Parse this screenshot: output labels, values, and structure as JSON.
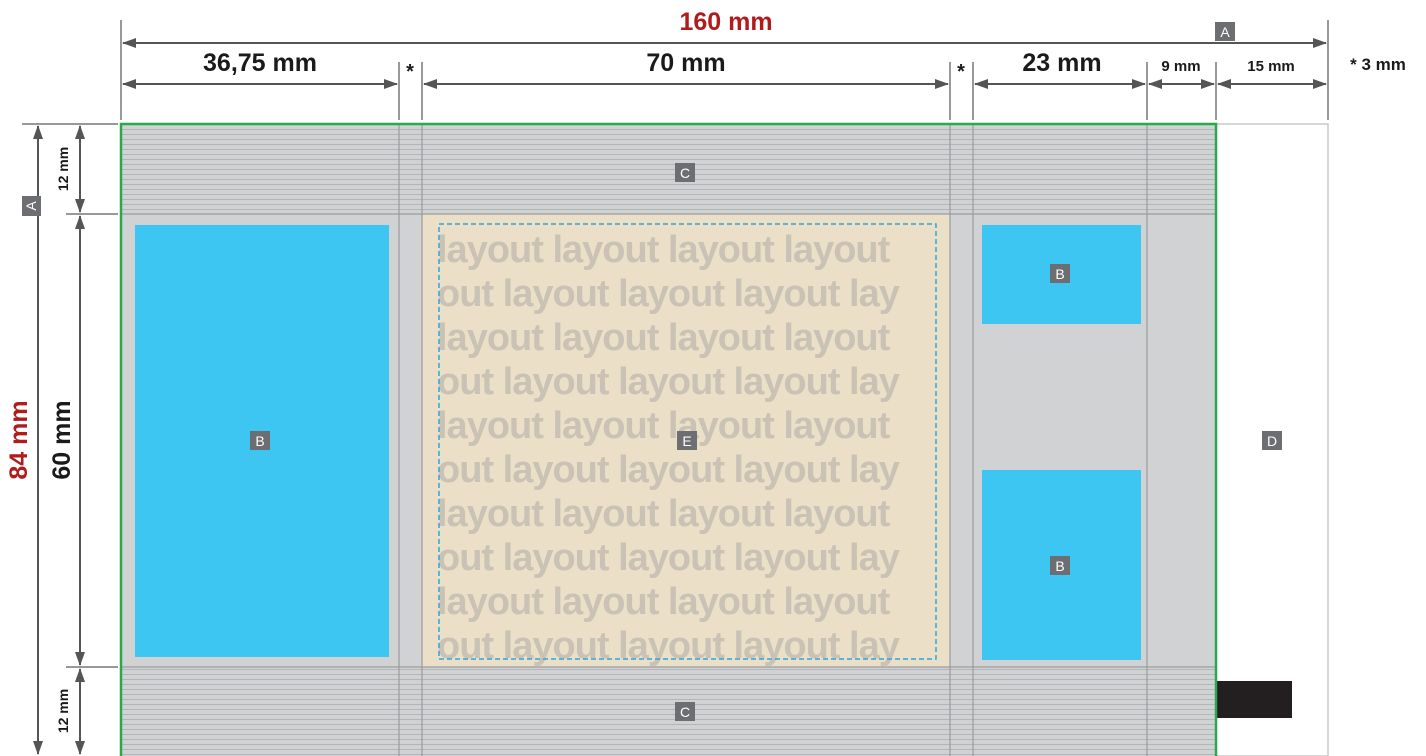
{
  "dimensions": {
    "total_width": "160 mm",
    "col1": "36,75 mm",
    "col2": "70 mm",
    "col3": "23 mm",
    "col4": "9 mm",
    "col5": "15 mm",
    "gap_marker": "*",
    "gap_note": "* 3 mm",
    "total_height": "84 mm",
    "row_top": "12 mm",
    "row_mid": "60 mm",
    "row_bottom": "12 mm"
  },
  "labels": {
    "a": "A",
    "b": "B",
    "c": "C",
    "d": "D",
    "e": "E"
  },
  "watermark": {
    "row_a": "layout  layout  layout  layout",
    "row_b": "out  layout  layout  layout  lay"
  },
  "colors": {
    "panel_grey": "#d1d2d4",
    "image_zone": "#3ec6f3",
    "text_zone": "#ebdfc7",
    "outline": "#2aa84a",
    "dim_red": "#b01c1c"
  }
}
